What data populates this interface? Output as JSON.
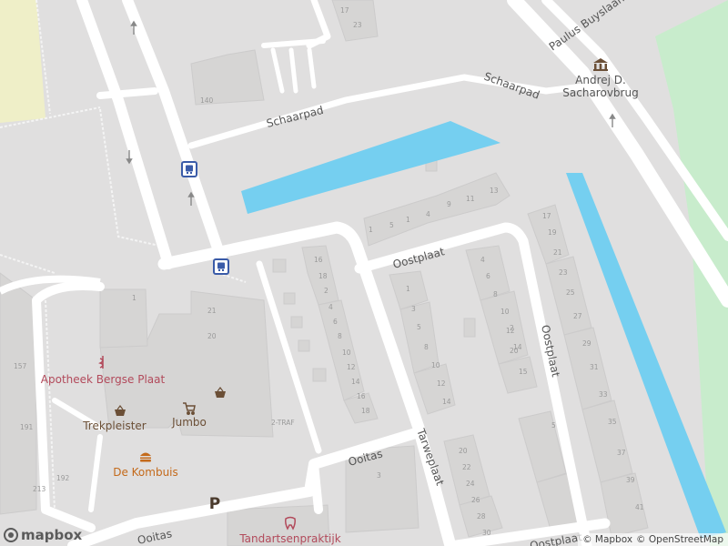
{
  "streets": {
    "paulus": "Paulus Buyslaan",
    "schaarpad_left": "Schaarpad",
    "schaarpad_right": "Schaarpad",
    "oostplaat_top": "Oostplaat",
    "oostplaat_right": "Oostplaat",
    "oostplaat_bottom": "Oostplaat",
    "tarweplaat": "Tarweplaat",
    "ooitas_mid": "Ooitas",
    "ooitas_bottom": "Ooitas"
  },
  "landmarks": {
    "bridge_line1": "Andrej D.",
    "bridge_line2": "Sacharovbrug"
  },
  "pois": {
    "pharmacy": "Apotheek Bergse Plaat",
    "trekpleister": "Trekpleister",
    "jumbo": "Jumbo",
    "kombuis": "De Kombuis",
    "dentist": "Tandartsenpraktijk",
    "parking": "P"
  },
  "house_numbers": [
    "140",
    "1",
    "17",
    "23",
    "157",
    "191",
    "213",
    "192",
    "2-TRAF",
    "20",
    "21",
    "1",
    "5",
    "1",
    "4",
    "9",
    "11",
    "13",
    "1",
    "3",
    "5",
    "8",
    "10",
    "12",
    "14",
    "15",
    "20",
    "2",
    "4",
    "6",
    "8",
    "10",
    "12",
    "14",
    "16",
    "18",
    "2",
    "4",
    "6",
    "8",
    "10",
    "12",
    "14",
    "16",
    "18",
    "20",
    "22",
    "24",
    "26",
    "28",
    "30",
    "17",
    "19",
    "21",
    "23",
    "25",
    "27",
    "29",
    "31",
    "33",
    "35",
    "37",
    "39",
    "41",
    "3",
    "5"
  ],
  "icons": {
    "bus_stop": "bus-stop-icon",
    "shop": "basket-icon",
    "supermarket": "cart-icon",
    "restaurant": "burger-icon",
    "pharmacy": "pharmacy-icon",
    "dentist": "tooth-icon",
    "monument": "museum-icon",
    "oneway": "arrow-icon"
  },
  "attribution": {
    "mapbox": "© Mapbox",
    "osm": "© OpenStreetMap"
  },
  "logo": "mapbox",
  "colors": {
    "background": "#e0dfdf",
    "building": "#d6d5d4",
    "road": "#ffffff",
    "water": "#75cff0",
    "park": "#c8eccc",
    "pitch": "#efefc8"
  }
}
